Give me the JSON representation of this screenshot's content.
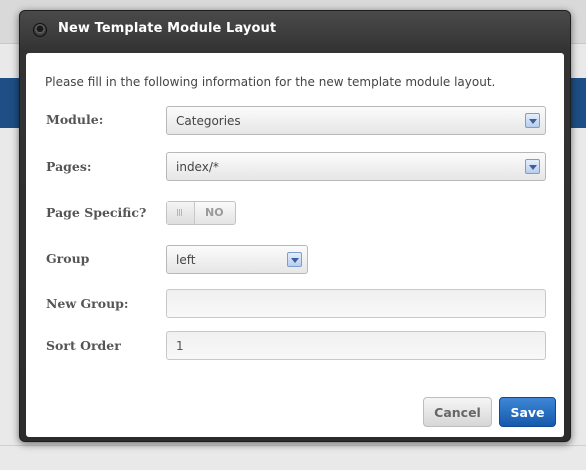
{
  "dialog": {
    "title": "New Template Module Layout",
    "intro": "Please fill in the following information for the new template module layout."
  },
  "form": {
    "module": {
      "label": "Module:",
      "value": "Categories"
    },
    "pages": {
      "label": "Pages:",
      "value": "index/*"
    },
    "page_specific": {
      "label": "Page Specific?",
      "state": "NO"
    },
    "group": {
      "label": "Group",
      "value": "left"
    },
    "new_group": {
      "label": "New Group:",
      "value": ""
    },
    "sort_order": {
      "label": "Sort Order",
      "value": "1"
    }
  },
  "buttons": {
    "cancel": "Cancel",
    "save": "Save"
  },
  "colors": {
    "header_bg": "#333333",
    "save_button": "#1e64b8",
    "background_band": "#1d4f86"
  }
}
